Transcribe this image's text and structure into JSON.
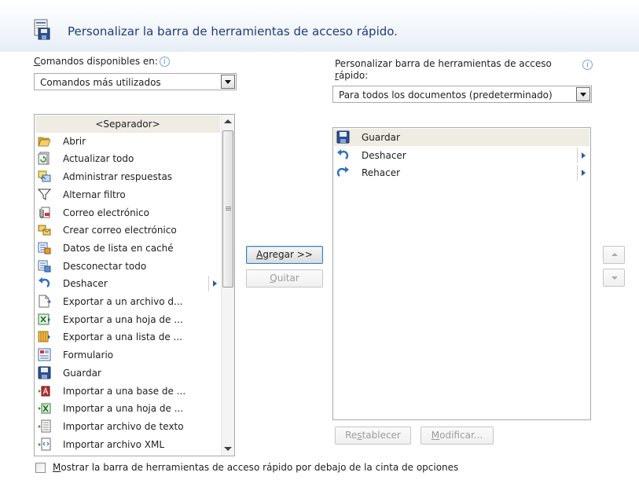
{
  "header": {
    "title": "Personalizar la barra de herramientas de acceso rápido.",
    "icon": "toolbar-customize-icon"
  },
  "available": {
    "label_accel": "C",
    "label_rest": "omandos disponibles en:",
    "info": "i",
    "combo_value": "Comandos más utilizados",
    "items": [
      {
        "label": "<Separador>",
        "icon": "separator"
      },
      {
        "label": "Abrir",
        "icon": "folder-open-icon"
      },
      {
        "label": "Actualizar todo",
        "icon": "refresh-all-icon"
      },
      {
        "label": "Administrar respuestas",
        "icon": "manage-replies-icon"
      },
      {
        "label": "Alternar filtro",
        "icon": "filter-icon"
      },
      {
        "label": "Correo electrónico",
        "icon": "email-attach-icon"
      },
      {
        "label": "Crear correo electrónico",
        "icon": "create-email-icon"
      },
      {
        "label": "Datos de lista en caché",
        "icon": "cached-list-icon"
      },
      {
        "label": "Desconectar todo",
        "icon": "disconnect-icon"
      },
      {
        "label": "Deshacer",
        "icon": "undo-icon",
        "submenu": true
      },
      {
        "label": "Exportar a un archivo d...",
        "icon": "export-file-icon"
      },
      {
        "label": "Exportar a una hoja de ...",
        "icon": "export-excel-icon"
      },
      {
        "label": "Exportar a una lista de ...",
        "icon": "export-list-icon"
      },
      {
        "label": "Formulario",
        "icon": "form-icon"
      },
      {
        "label": "Guardar",
        "icon": "save-icon"
      },
      {
        "label": "Importar a una base de ...",
        "icon": "import-access-icon"
      },
      {
        "label": "Importar a una hoja de ...",
        "icon": "import-excel-icon"
      },
      {
        "label": "Importar archivo de texto",
        "icon": "import-text-icon"
      },
      {
        "label": "Importar archivo XML",
        "icon": "import-xml-icon"
      }
    ]
  },
  "buttons": {
    "add_accel": "A",
    "add_rest": "gregar >>",
    "remove_accel": "Q",
    "remove_rest": "uitar",
    "reset_pre": "Re",
    "reset_accel": "s",
    "reset_post": "tablecer",
    "modify_accel": "M",
    "modify_rest": "odificar..."
  },
  "customize": {
    "label_line1": "Personalizar barra de herramientas de acceso",
    "label_line2_accel": "r",
    "label_line2_rest": "ápido:",
    "info": "i",
    "combo_value": "Para todos los documentos (predeterminado)",
    "items": [
      {
        "label": "Guardar",
        "icon": "save-icon"
      },
      {
        "label": "Deshacer",
        "icon": "undo-icon",
        "submenu": true
      },
      {
        "label": "Rehacer",
        "icon": "redo-icon",
        "submenu": true
      }
    ]
  },
  "footer": {
    "checkbox_accel": "M",
    "checkbox_rest": "ostrar la barra de herramientas de acceso rápido por debajo de la cinta de opciones",
    "checked": false
  },
  "colors": {
    "title": "#1f3c78",
    "selection": "#eeece3",
    "accent": "#2a5da8"
  }
}
